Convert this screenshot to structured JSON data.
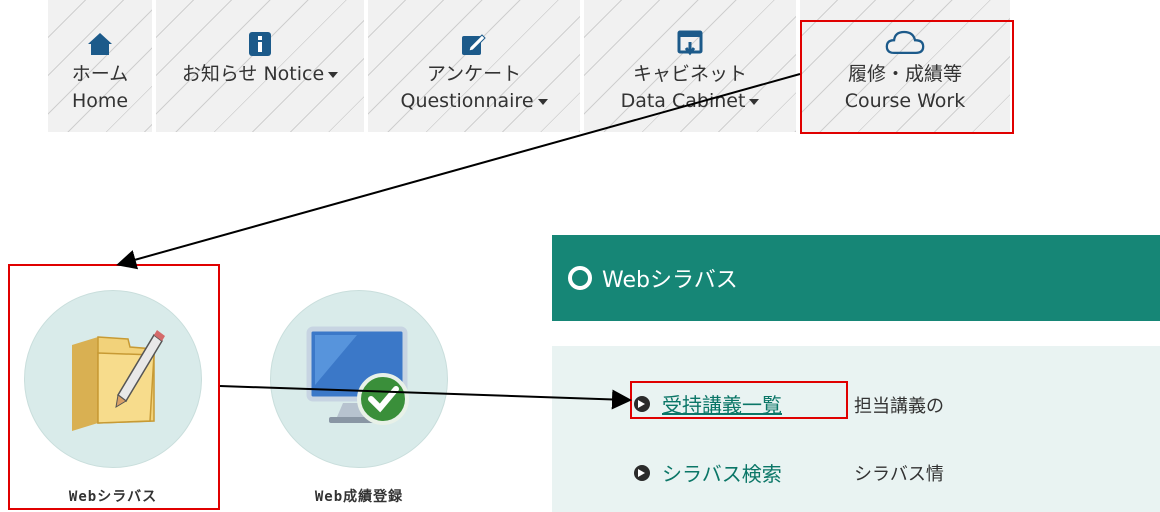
{
  "nav": {
    "items": [
      {
        "jp": "ホーム",
        "en": "Home",
        "icon": "home-icon"
      },
      {
        "jp": "お知らせ Notice",
        "en": "",
        "icon": "info-icon"
      },
      {
        "jp": "アンケート",
        "en": "Questionnaire",
        "icon": "edit-icon"
      },
      {
        "jp": "キャビネット",
        "en": "Data Cabinet",
        "icon": "cabinet-download-icon"
      },
      {
        "jp": "履修・成績等",
        "en": "Course Work",
        "icon": "cloud-icon"
      }
    ]
  },
  "tiles": [
    {
      "caption": "Webシラバス",
      "icon": "folder-pencil-icon"
    },
    {
      "caption": "Web成績登録",
      "icon": "monitor-check-icon"
    }
  ],
  "panel": {
    "title": "Webシラバス",
    "rows": [
      {
        "label": "受持講義一覧",
        "desc": "担当講義の"
      },
      {
        "label": "シラバス検索",
        "desc": "シラバス情"
      }
    ]
  },
  "colors": {
    "panel_header": "#168676",
    "panel_body": "#e9f3f2",
    "nav_icon": "#1c5a8a",
    "highlight": "#e00000"
  }
}
